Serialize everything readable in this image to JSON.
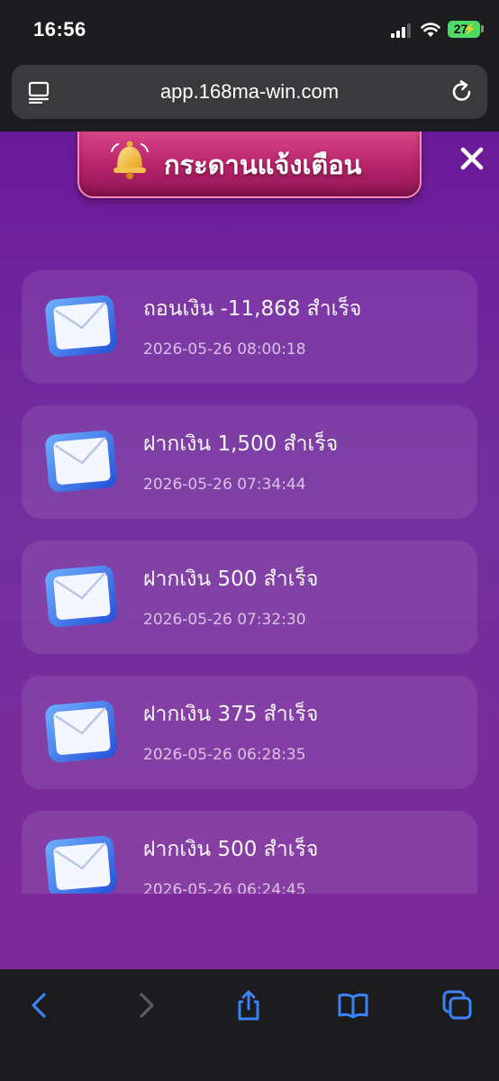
{
  "status_bar": {
    "time": "16:56",
    "battery": "27"
  },
  "browser": {
    "url": "app.168ma-win.com"
  },
  "panel": {
    "title": "กระดานแจ้งเตือน"
  },
  "notifications": [
    {
      "title": "ถอนเงิน -11,868 สำเร็จ",
      "time": "2026-05-26 08:00:18"
    },
    {
      "title": "ฝากเงิน 1,500 สำเร็จ",
      "time": "2026-05-26 07:34:44"
    },
    {
      "title": "ฝากเงิน 500 สำเร็จ",
      "time": "2026-05-26 07:32:30"
    },
    {
      "title": "ฝากเงิน 375 สำเร็จ",
      "time": "2026-05-26 06:28:35"
    },
    {
      "title": "ฝากเงิน 500 สำเร็จ",
      "time": "2026-05-26 06:24:45"
    }
  ],
  "icons": {
    "reader": "reader-icon",
    "reload": "reload-icon",
    "bell": "bell-icon",
    "close": "close-icon",
    "mail": "mail-icon",
    "back": "back-icon",
    "forward": "forward-icon",
    "share": "share-icon",
    "bookmarks": "bookmarks-icon",
    "tabs": "tabs-icon"
  },
  "colors": {
    "accent": "#3b82f6",
    "panel_bg": "#6b1a9a",
    "title_bar": "#c72e76"
  }
}
